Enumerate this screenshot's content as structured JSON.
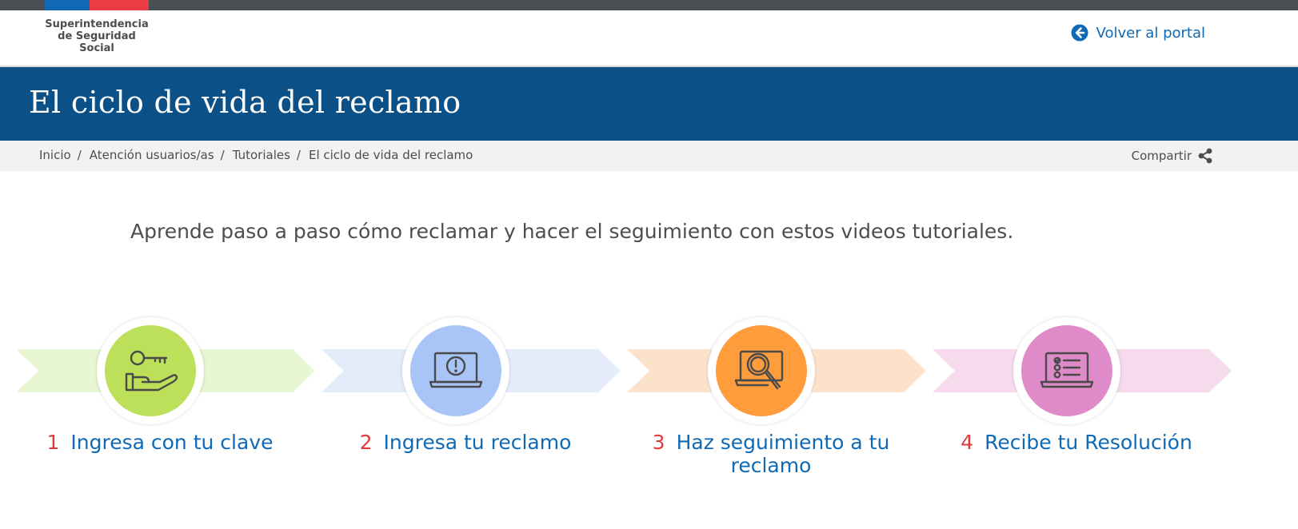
{
  "header": {
    "logo_lines": [
      "Superintendencia",
      "de Seguridad",
      "Social"
    ],
    "back_label": "Volver al portal"
  },
  "page": {
    "title": "El ciclo de vida del reclamo",
    "intro": "Aprende paso a paso cómo reclamar y hacer el seguimiento con estos videos tutoriales."
  },
  "breadcrumb": {
    "items": [
      "Inicio",
      "Atención usuarios/as",
      "Tutoriales",
      "El ciclo de vida del reclamo"
    ],
    "separator": "/"
  },
  "share": {
    "label": "Compartir",
    "icon": "share-icon"
  },
  "colors": {
    "flag_blue": "#0f69b4",
    "flag_red": "#eb3c46",
    "title_band": "#0b5087",
    "link_blue": "#0f69b4",
    "step_number_red": "#e03b3b"
  },
  "steps": [
    {
      "number": "1",
      "label": "Ingresa con tu clave",
      "icon": "key-hand-icon",
      "circle_color": "#bde05a",
      "arrow_color": "#e8f6d4"
    },
    {
      "number": "2",
      "label": "Ingresa tu reclamo",
      "icon": "laptop-alert-icon",
      "circle_color": "#a9c5f7",
      "arrow_color": "#e4ecfb"
    },
    {
      "number": "3",
      "label": "Haz seguimiento a tu reclamo",
      "icon": "laptop-search-icon",
      "circle_color": "#ff9c3b",
      "arrow_color": "#fde2cb"
    },
    {
      "number": "4",
      "label": "Recibe tu Resolución",
      "icon": "laptop-checklist-icon",
      "circle_color": "#e08bc9",
      "arrow_color": "#f6dbed"
    }
  ]
}
